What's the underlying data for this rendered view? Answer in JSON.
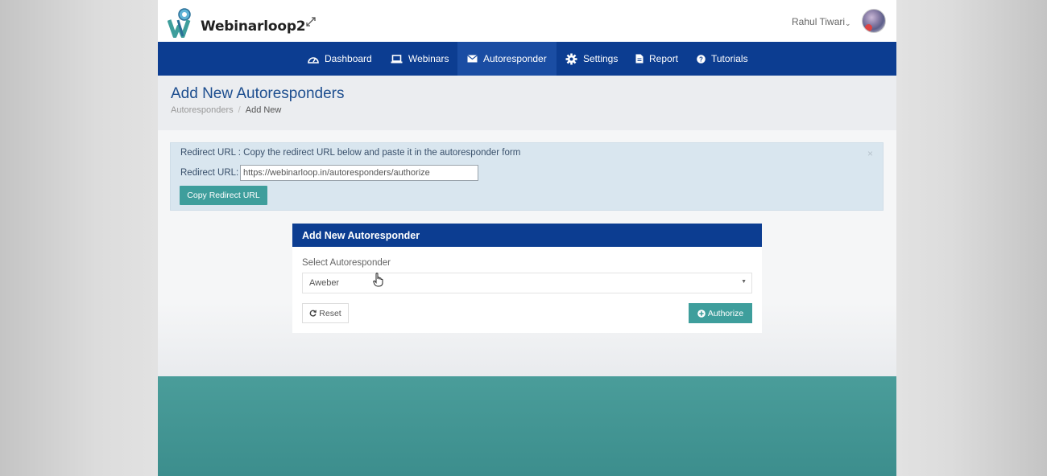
{
  "app": {
    "brand": "Webinarloop2",
    "user_name": "Rahul Tiwari",
    "user_caret": "⌄"
  },
  "nav": {
    "items": [
      {
        "label": "Dashboard",
        "icon": "dashboard-icon"
      },
      {
        "label": "Webinars",
        "icon": "laptop-icon"
      },
      {
        "label": "Autoresponder",
        "icon": "envelope-icon",
        "active": true
      },
      {
        "label": "Settings",
        "icon": "gear-icon"
      },
      {
        "label": "Report",
        "icon": "document-icon"
      },
      {
        "label": "Tutorials",
        "icon": "question-circle-icon"
      }
    ]
  },
  "page": {
    "title": "Add New Autoresponders",
    "breadcrumb": {
      "parent": "Autoresponders",
      "separator": "/",
      "current": "Add New"
    }
  },
  "alert": {
    "message": "Redirect URL : Copy the redirect URL below and paste it in the autoresponder form",
    "url_label": "Redirect URL:",
    "url_value": "https://webinarloop.in/autoresponders/authorize",
    "copy_button": "Copy Redirect URL",
    "close": "×"
  },
  "card": {
    "title": "Add New Autoresponder",
    "select_label": "Select Autoresponder",
    "selected": "Aweber",
    "reset_button": "Reset",
    "authorize_button": "Authorize"
  },
  "colors": {
    "nav_bg": "#0c3d91",
    "accent_teal": "#3e9e9c",
    "title_blue": "#1d4e8f",
    "alert_bg": "#d9e6ef"
  }
}
